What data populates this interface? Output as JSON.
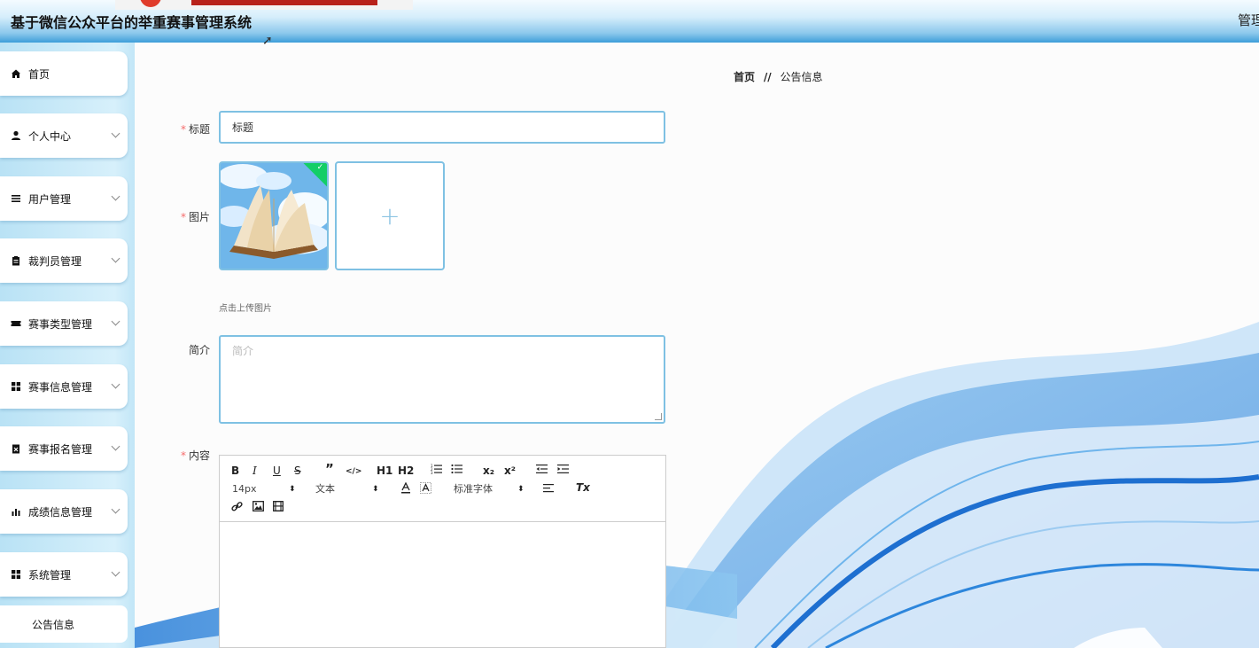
{
  "header": {
    "title": "基于微信公众平台的举重赛事管理系统",
    "user_label": "管理"
  },
  "sidebar": {
    "items": [
      {
        "label": "首页",
        "icon": "home-icon",
        "has_chevron": false
      },
      {
        "label": "个人中心",
        "icon": "user-icon",
        "has_chevron": true
      },
      {
        "label": "用户管理",
        "icon": "list-icon",
        "has_chevron": true
      },
      {
        "label": "裁判员管理",
        "icon": "clipboard-icon",
        "has_chevron": true
      },
      {
        "label": "赛事类型管理",
        "icon": "ticket-icon",
        "has_chevron": true
      },
      {
        "label": "赛事信息管理",
        "icon": "grid-icon",
        "has_chevron": true
      },
      {
        "label": "赛事报名管理",
        "icon": "checklist-icon",
        "has_chevron": true
      },
      {
        "label": "成绩信息管理",
        "icon": "bar-chart-icon",
        "has_chevron": true
      },
      {
        "label": "系统管理",
        "icon": "grid-icon",
        "has_chevron": true
      }
    ],
    "sub_item": "公告信息"
  },
  "breadcrumb": {
    "home": "首页",
    "separator": "//",
    "current": "公告信息"
  },
  "form": {
    "title_label": "标题",
    "title_value": "标题",
    "image_label": "图片",
    "upload_tip": "点击上传图片",
    "intro_label": "简介",
    "intro_placeholder": "简介",
    "content_label": "内容"
  },
  "editor_toolbar": {
    "bold": "B",
    "italic": "I",
    "underline": "U",
    "strike": "S",
    "quote": "”",
    "code": "</>",
    "h1": "H1",
    "h2": "H2",
    "sub": "x₂",
    "sup": "x²",
    "font_size": "14px",
    "paragraph": "文本",
    "font_family": "标准字体",
    "clean": "Tx"
  },
  "colors": {
    "accent": "#3d9ed9",
    "border_blue": "#7fc1e3",
    "required": "#f56c6c",
    "success": "#13ce66"
  }
}
